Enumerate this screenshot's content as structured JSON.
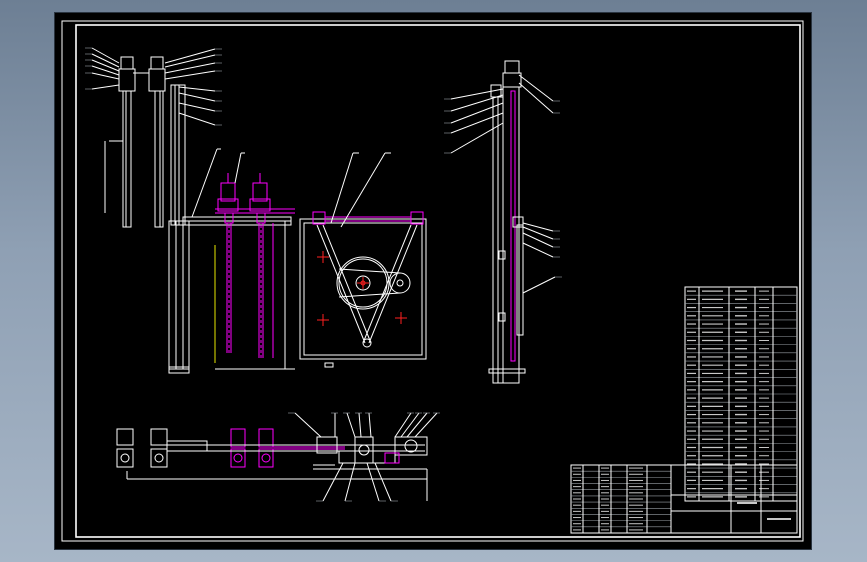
{
  "canvas": {
    "background_color": "#000000",
    "frame_color": "#ffffff",
    "accent_colors": {
      "part_lines": "#ff00ff",
      "center_marks": "#ff2020",
      "outline": "#ffffff",
      "hidden": "#e8e800"
    }
  },
  "views": [
    {
      "name": "side-elevation-left",
      "content": "linework"
    },
    {
      "name": "front-elevation",
      "content": "linework"
    },
    {
      "name": "side-elevation-right",
      "content": "linework"
    },
    {
      "name": "plan-view",
      "content": "linework"
    }
  ],
  "parts_list": {
    "rows": 26,
    "columns": 5
  },
  "title_block": {
    "rows": 11,
    "columns": 8
  }
}
